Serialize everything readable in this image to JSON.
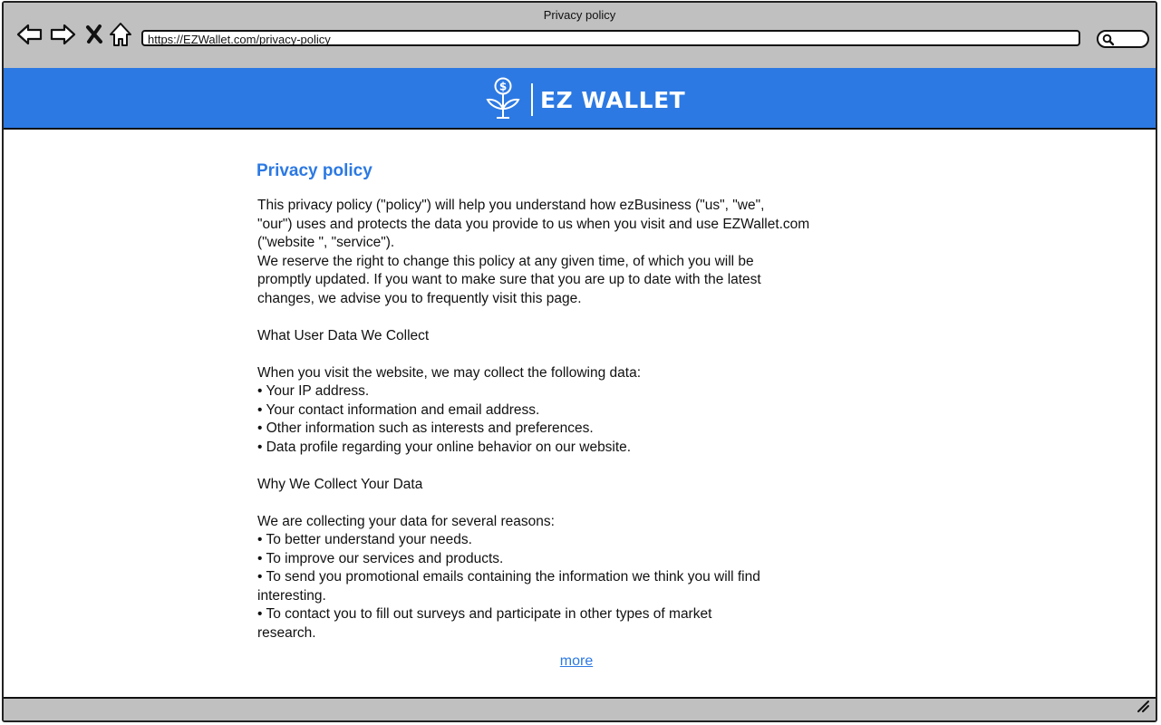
{
  "window": {
    "title": "Privacy policy"
  },
  "browser": {
    "url": "https://EZWallet.com/privacy-policy",
    "icons": [
      "back-arrow-icon",
      "forward-arrow-icon",
      "close-x-icon",
      "home-icon",
      "search-icon"
    ]
  },
  "brand": {
    "name": "EZ WALLET",
    "logo_icon": "money-plant-icon",
    "color": "#2c79e3"
  },
  "page": {
    "title": "Privacy policy",
    "intro": [
      "This privacy policy (\"policy\") will help you understand how ezBusiness (\"us\", \"we\",",
      "\"our\") uses and protects the data you provide to us when you visit and use EZWallet.com",
      "(\"website \", \"service\").",
      "We reserve the right to change this policy at any given time, of which you will be",
      "promptly updated. If you want to make sure that you are up to date with the latest",
      "changes, we advise you to frequently visit this page."
    ],
    "section1_heading": "What User Data We Collect",
    "section1_lead": "When you visit the website, we may collect the following data:",
    "section1_items": [
      "• Your IP address.",
      "• Your contact information and email address.",
      "• Other information such as interests and preferences.",
      "• Data profile regarding your online behavior on our website."
    ],
    "section2_heading": "Why We Collect Your Data",
    "section2_lead": "We are collecting your data for several reasons:",
    "section2_items": [
      "• To better understand your needs.",
      "• To improve our services and products.",
      "• To send you promotional emails containing the information we think you will find",
      "interesting.",
      "• To contact you to fill out surveys and participate in other types of market",
      "research."
    ],
    "more_link": "more"
  }
}
